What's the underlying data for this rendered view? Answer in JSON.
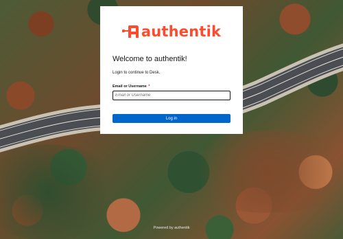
{
  "brand": {
    "name": "authentik",
    "color": "#fd4b2d",
    "icon": "authentik-logo-icon"
  },
  "login": {
    "title": "Welcome to authentik!",
    "subtitle": "Login to continue to Desk.",
    "field_label": "Email or Username",
    "required_marker": "*",
    "field_placeholder": "Email or Username",
    "field_value": "",
    "submit_label": "Log in"
  },
  "footer": {
    "text": "Powered by authentik"
  },
  "colors": {
    "primary_button": "#0066cc",
    "card_background": "#ffffff"
  }
}
